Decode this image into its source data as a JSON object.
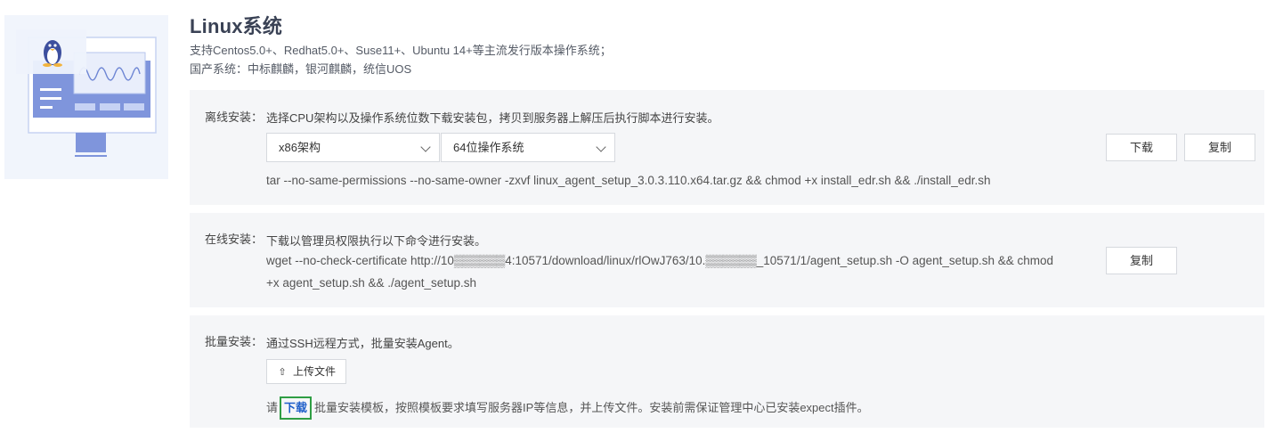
{
  "header": {
    "title": "Linux系统",
    "desc_line1": "支持Centos5.0+、Redhat5.0+、Suse11+、Ubuntu 14+等主流发行版本操作系统；",
    "desc_line2": "国产系统：中标麒麟，银河麒麟，统信UOS"
  },
  "illustration": {
    "icon": "linux-penguin-monitor-icon"
  },
  "offline": {
    "label": "离线安装：",
    "text": "选择CPU架构以及操作系统位数下载安装包，拷贝到服务器上解压后执行脚本进行安装。",
    "arch_select": "x86架构",
    "os_select": "64位操作系统",
    "download_label": "下载",
    "copy_label": "复制",
    "command": "tar --no-same-permissions --no-same-owner -zxvf linux_agent_setup_3.0.3.110.x64.tar.gz && chmod +x install_edr.sh && ./install_edr.sh"
  },
  "online": {
    "label": "在线安装：",
    "text": "下载以管理员权限执行以下命令进行安装。",
    "command_line1": "wget --no-check-certificate http://10▒▒▒▒▒▒4:10571/download/linux/rlOwJ763/10.▒▒▒▒▒▒_10571/1/agent_setup.sh -O agent_setup.sh && chmod",
    "command_line2": "+x agent_setup.sh && ./agent_setup.sh",
    "copy_label": "复制"
  },
  "batch": {
    "label": "批量安装：",
    "text": "通过SSH远程方式，批量安装Agent。",
    "upload_label": "上传文件",
    "hint_prefix": "请",
    "hint_link": "下载",
    "hint_suffix": "批量安装模板，按照模板要求填写服务器IP等信息，并上传文件。安装前需保证管理中心已安装expect插件。"
  },
  "colors": {
    "accent": "#1f5fc9",
    "panel_bg": "#f5f6f8",
    "illustration": "#7189d6",
    "highlight_box": "#2f9e44"
  }
}
